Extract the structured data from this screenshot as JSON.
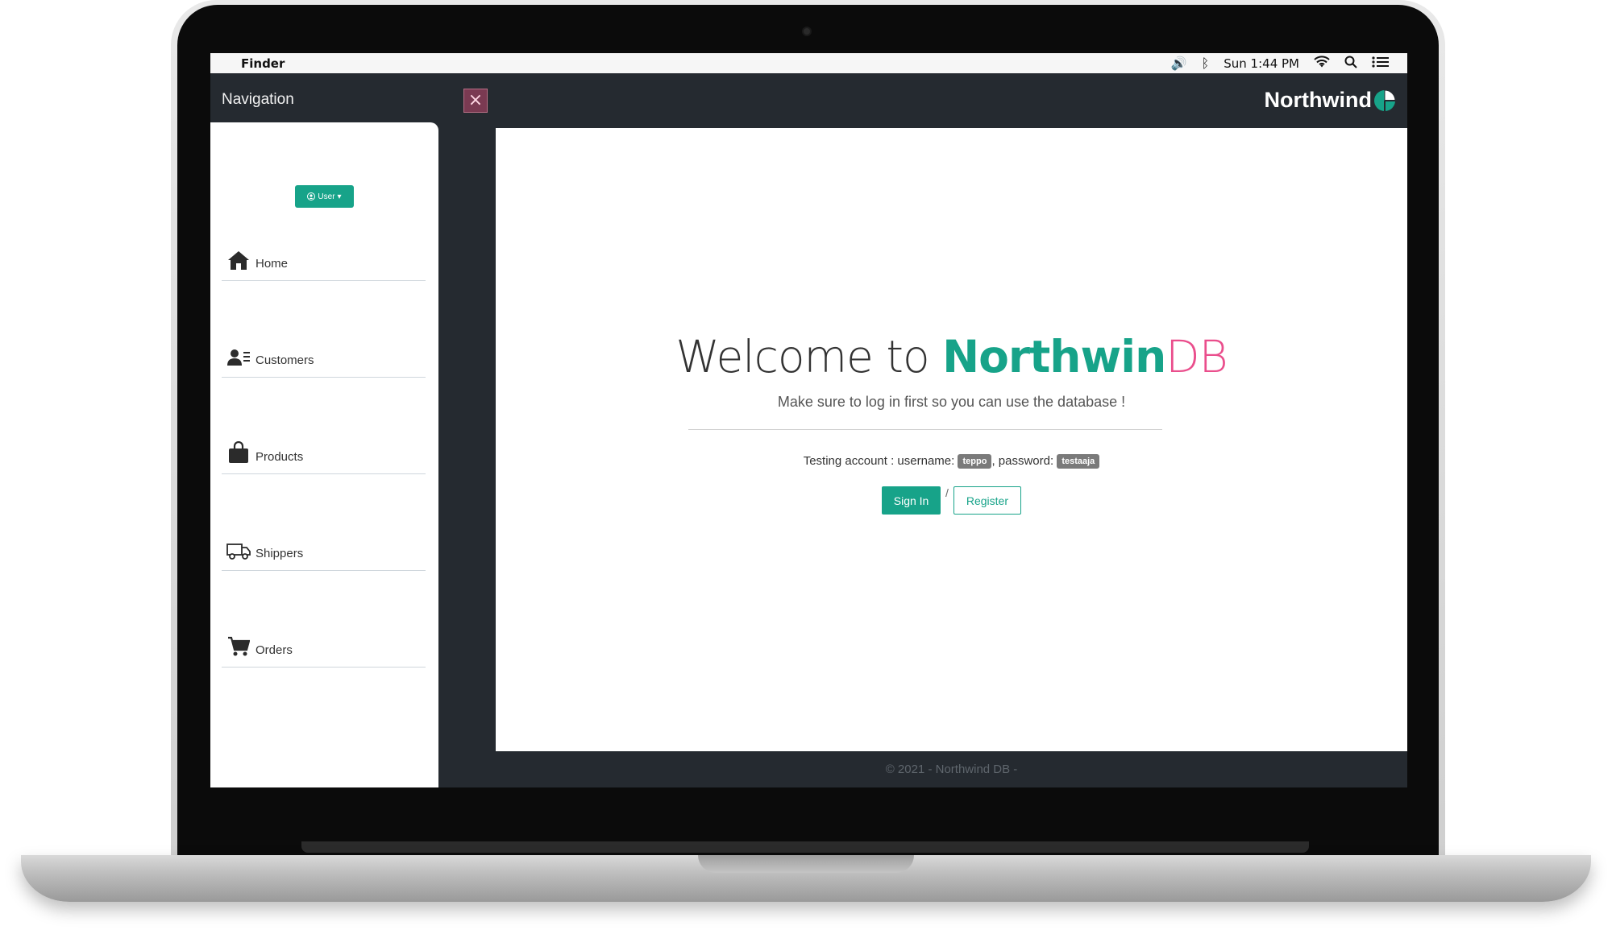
{
  "menubar": {
    "apple_icon": "apple-icon",
    "app_name": "Finder",
    "clock": "Sun 1:44 PM"
  },
  "nav": {
    "title": "Navigation",
    "close_label": "×",
    "user_button": "User",
    "items": [
      {
        "label": "Home",
        "icon": "home-icon"
      },
      {
        "label": "Customers",
        "icon": "customers-icon"
      },
      {
        "label": "Products",
        "icon": "bag-icon"
      },
      {
        "label": "Shippers",
        "icon": "truck-icon"
      },
      {
        "label": "Orders",
        "icon": "cart-icon"
      }
    ]
  },
  "header": {
    "brand": "Northwind"
  },
  "main": {
    "welcome_prefix": "Welcome to ",
    "welcome_brand_a": "Northwin",
    "welcome_brand_b": "DB",
    "subtitle": "Make sure to log in first so you can use the database !",
    "testing_prefix": "Testing account : username:",
    "username": "teppo",
    "password_label": ", password:",
    "password": "testaaja",
    "signin_label": "Sign In",
    "separator": "/",
    "register_label": "Register"
  },
  "footer": {
    "text": "© 2021 - Northwind DB -"
  },
  "colors": {
    "accent": "#17a389",
    "pink": "#ea4e8c",
    "dark": "#252a30"
  }
}
